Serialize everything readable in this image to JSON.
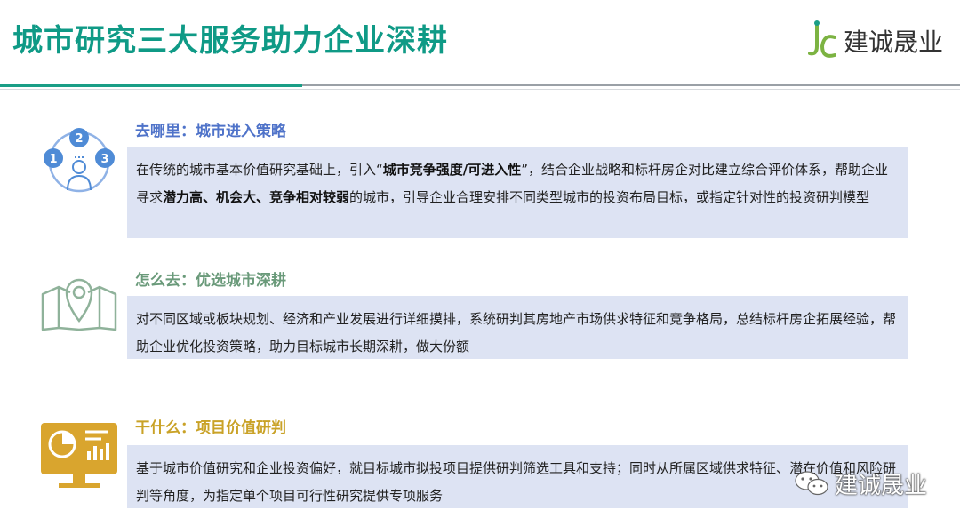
{
  "page": {
    "title": "城市研究三大服务助力企业深耕"
  },
  "brand": {
    "logo_text": "建诚晟业",
    "watermark_text": "建诚晟业",
    "colors": {
      "title": "#0f9a86",
      "logo_green": "#7cb342",
      "accent_teal": "#1a9e86"
    }
  },
  "sections": [
    {
      "icon": "people-choice-icon",
      "title": "去哪里：城市进入策略",
      "title_color": "#4f73c9",
      "body": {
        "p1": "在传统的城市基本价值研究基础上，引入“",
        "b1": "城市竞争强度/可进入性",
        "p2": "”，结合企业战略和标杆房企对比建立综合评价体系，帮助企业寻求",
        "b2": "潜力高、机会大、竞争相对较弱",
        "p3": "的城市，引导企业合理安排不同类型城市的投资布局目标，或指定针对性的投资研判模型"
      },
      "icon_labels": [
        "2",
        "1",
        "3"
      ]
    },
    {
      "icon": "map-pin-icon",
      "title": "怎么去：优选城市深耕",
      "title_color": "#6a9a7a",
      "body": {
        "p1": "对不同区域或板块规划、经济和产业发展进行详细摸排，系统研判其房地产市场供求特征和竞争格局，总结标杆房企拓展经验，帮助企业优化投资策略，助力目标城市长期深耕，做大份额"
      }
    },
    {
      "icon": "monitor-chart-icon",
      "title": "干什么：项目价值研判",
      "title_color": "#c9a227",
      "body": {
        "p1": "基于城市价值研究和企业投资偏好，就目标城市拟投项目提供研判筛选工具和支持；同时从所属区域供求特征、潜在价值和风险研判等角度，为指定单个项目可行性研究提供专项服务"
      }
    }
  ]
}
